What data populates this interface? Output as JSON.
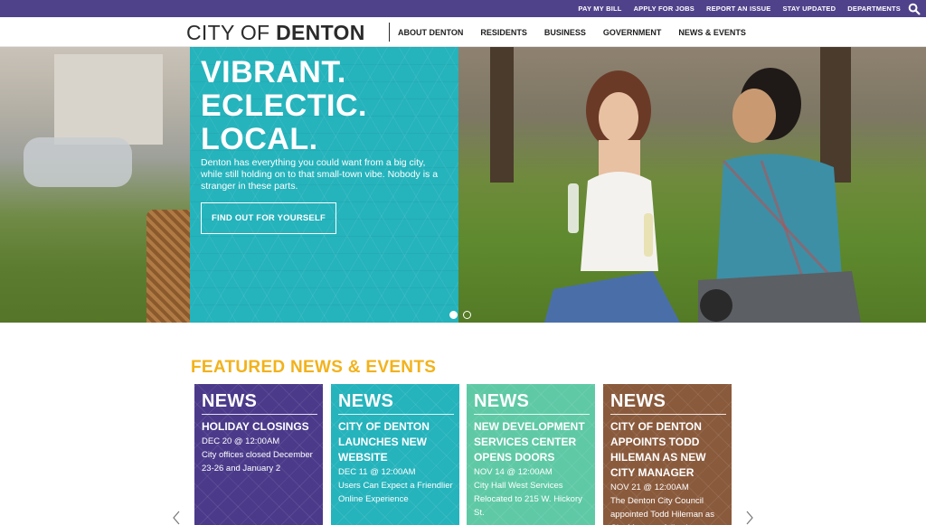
{
  "utility_nav": [
    "PAY MY BILL",
    "APPLY FOR JOBS",
    "REPORT AN ISSUE",
    "STAY UPDATED",
    "DEPARTMENTS"
  ],
  "logo": {
    "light": "CITY OF ",
    "bold": "DENTON"
  },
  "main_nav": [
    "ABOUT DENTON",
    "RESIDENTS",
    "BUSINESS",
    "GOVERNMENT",
    "NEWS & EVENTS"
  ],
  "hero": {
    "headline": [
      "VIBRANT.",
      "ECLECTIC.",
      "LOCAL."
    ],
    "body": "Denton has everything you could want from a big city, while still holding on to that small-town vibe. Nobody is a stranger in these parts.",
    "cta": "FIND OUT FOR YOURSELF"
  },
  "featured": {
    "title": "FEATURED NEWS & EVENTS",
    "cards": [
      {
        "kicker": "NEWS",
        "title": "HOLIDAY CLOSINGS",
        "date": "DEC 20 @ 12:00AM",
        "text": "City offices closed December 23-26 and January 2",
        "color": "#4b3a8a"
      },
      {
        "kicker": "NEWS",
        "title": "CITY OF DENTON LAUNCHES NEW WEBSITE",
        "date": "DEC 11 @ 12:00AM",
        "text": "Users Can Expect a Friendlier Online Experience",
        "color": "#25b3bc"
      },
      {
        "kicker": "NEWS",
        "title": "NEW DEVELOPMENT SERVICES CENTER OPENS DOORS",
        "date": "NOV 14 @ 12:00AM",
        "text": "City Hall West Services Relocated to 215 W. Hickory St.",
        "color": "#5fc9a6"
      },
      {
        "kicker": "NEWS",
        "title": "CITY OF DENTON APPOINTS TODD HILEMAN AS NEW CITY MANAGER",
        "date": "NOV 21 @ 12:00AM",
        "text": "The Denton City Council appointed Todd Hileman as City Manager following",
        "color": "#8a5a3c"
      }
    ]
  },
  "colors": {
    "utility_bar": "#50428a",
    "teal": "#25b3bc",
    "gold": "#f2b21b"
  }
}
